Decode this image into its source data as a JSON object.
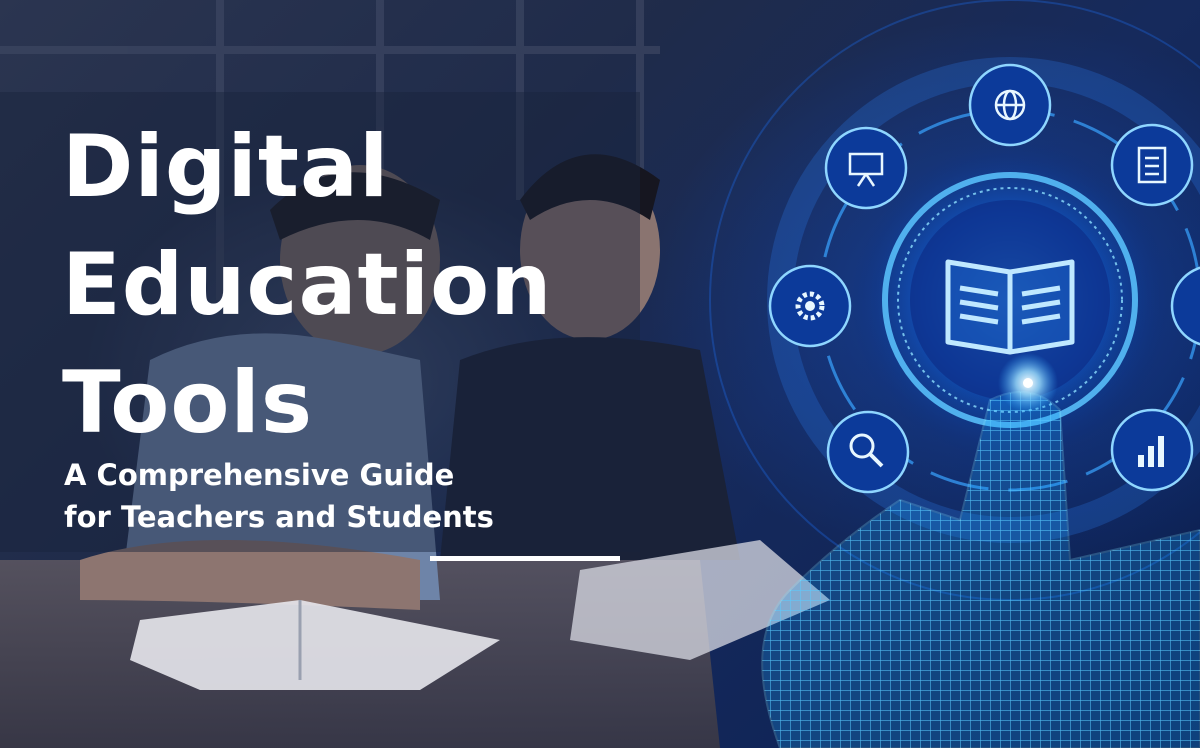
{
  "headline": {
    "line1": "Digital",
    "line2": "Education",
    "line3": "Tools"
  },
  "subheadline": {
    "line1": "A Comprehensive Guide",
    "line2": "for Teachers and Students"
  },
  "colors": {
    "accent_glow": "#2fa8ff",
    "text": "#ffffff",
    "background_dark": "#0b1a3c"
  },
  "icons": [
    "globe-icon",
    "clipboard-icon",
    "presentation-icon",
    "gear-icon",
    "open-book-icon",
    "magnifier-icon",
    "bar-chart-icon"
  ]
}
